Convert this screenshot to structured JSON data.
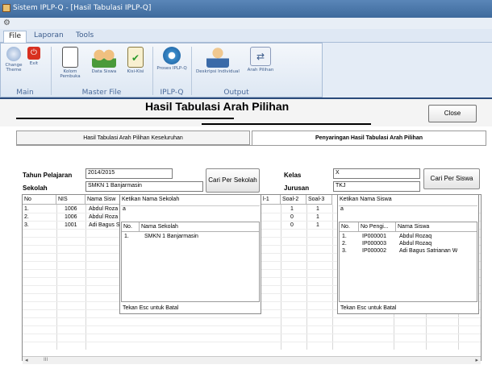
{
  "window": {
    "title": "Sistem IPLP-Q - [Hasil Tabulasi IPLP-Q]"
  },
  "menu": {
    "file": "File",
    "laporan": "Laporan",
    "tools": "Tools"
  },
  "ribbon": {
    "groups": [
      {
        "name": "Main",
        "buttons": [
          "Change Theme",
          "Exit"
        ]
      },
      {
        "name": "Master File",
        "buttons": [
          "Kolom Pembuka",
          "Data Siswa",
          "Kisi-Kisi"
        ]
      },
      {
        "name": "IPLP-Q",
        "buttons": [
          "Proses IPLP-Q"
        ]
      },
      {
        "name": "Output",
        "buttons": [
          "Deskripsi Individual",
          "Arah Pilihan"
        ]
      }
    ]
  },
  "header": {
    "title": "Hasil Tabulasi Arah Pilihan",
    "close_label": "Close"
  },
  "tabs": [
    {
      "label": "Hasil Tabulasi Arah Pilihan Keseluruhan"
    },
    {
      "label": "Penyaringan Hasil Tabulasi Arah Pilihan"
    }
  ],
  "filter": {
    "tahun_label": "Tahun Pelajaran",
    "tahun_value": "2014/2015",
    "sekolah_label": "Sekolah",
    "sekolah_value": "SMKN 1 Banjarmasin",
    "cari_sekolah": "Cari Per Sekolah",
    "kelas_label": "Kelas",
    "kelas_value": "X",
    "jurusan_label": "Jurusan",
    "jurusan_value": "TKJ",
    "cari_siswa": "Cari Per Siswa"
  },
  "grid": {
    "headers": [
      "No",
      "NIS",
      "Nama Sisw",
      "l-1",
      "Soal-2",
      "Soal-3"
    ],
    "rows": [
      [
        "1.",
        "1006",
        "Abdul Roza",
        "1",
        "1"
      ],
      [
        "2.",
        "1006",
        "Abdul Roza",
        "0",
        "1"
      ],
      [
        "3.",
        "1001",
        "Adi Bagus S",
        "0",
        "1"
      ]
    ]
  },
  "school_popup": {
    "title": "Ketikan Nama Sekolah",
    "query": "a",
    "headers": [
      "No.",
      "Nama Sekolah"
    ],
    "rows": [
      [
        "1.",
        "SMKN 1 Banjarmasin"
      ]
    ],
    "footer": "Tekan Esc untuk Batal"
  },
  "student_popup": {
    "title": "Ketikan Nama Siswa",
    "query": "a",
    "headers": [
      "No.",
      "No Pengi...",
      "Nama Siswa"
    ],
    "rows": [
      [
        "1.",
        "IP000001",
        "Abdul Rozaq"
      ],
      [
        "2.",
        "IP000003",
        "Abdul Rozaq"
      ],
      [
        "3.",
        "IP000002",
        "Adi Bagus Satrianan W"
      ]
    ],
    "footer": "Tekan Esc untuk Batal"
  },
  "scrollbar": {
    "left": "◂",
    "thumb": "III",
    "right": "▸"
  }
}
